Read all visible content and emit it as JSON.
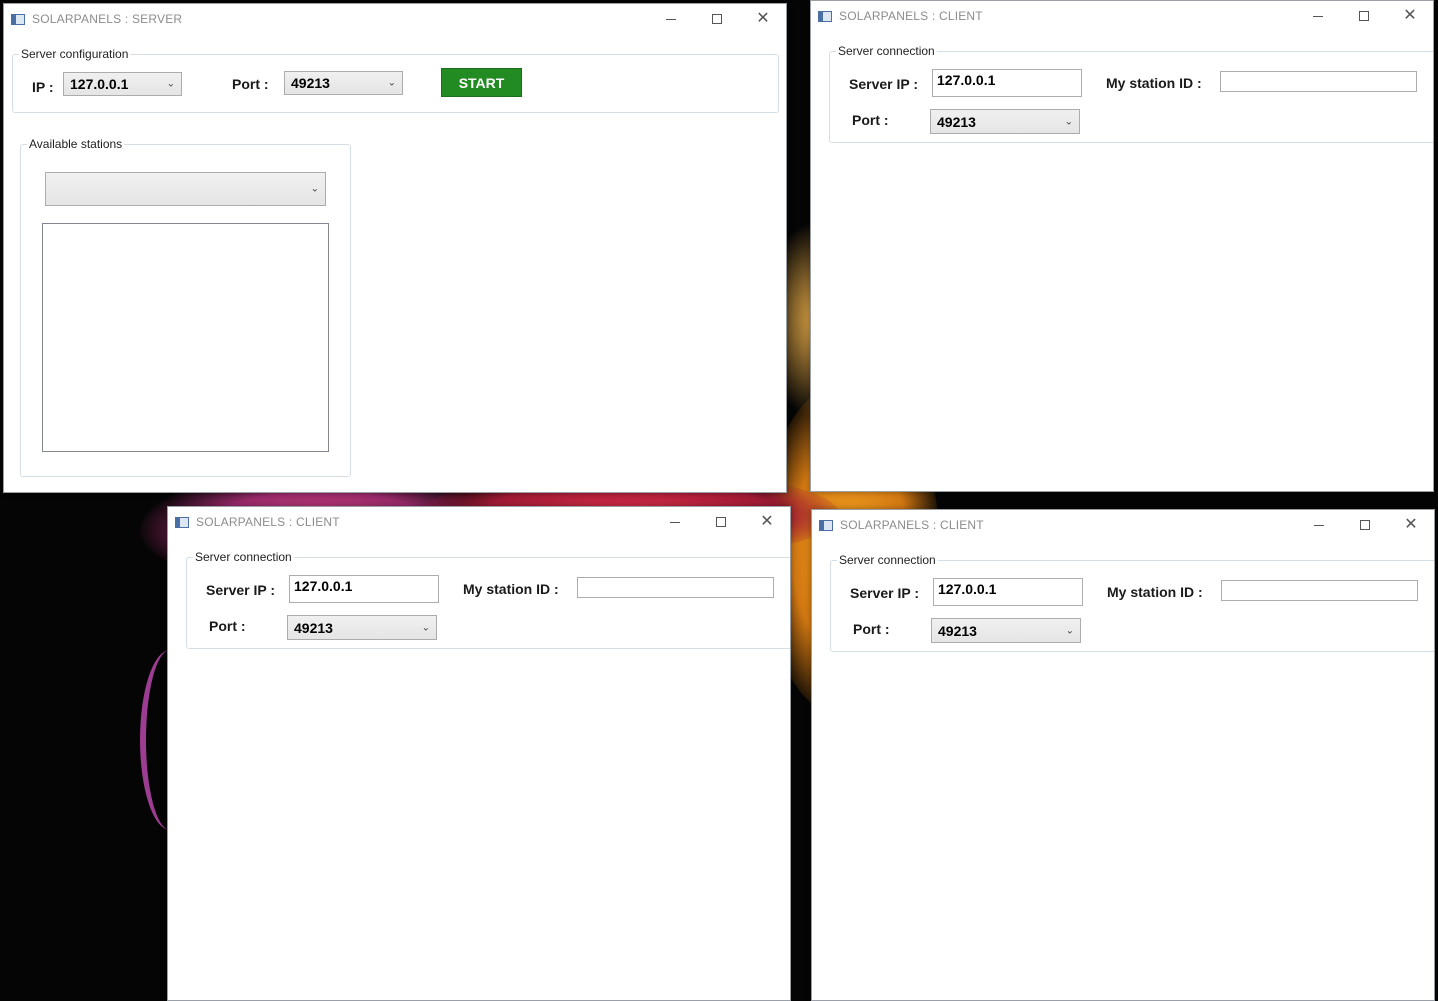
{
  "server_window": {
    "title": "SOLARPANELS : SERVER",
    "config_group": "Server configuration",
    "ip_label": "IP :",
    "ip_value": "127.0.0.1",
    "port_label": "Port :",
    "port_value": "49213",
    "start_label": "START",
    "stations_group": "Available stations",
    "stations_selected": ""
  },
  "client_windows": [
    {
      "title": "SOLARPANELS : CLIENT",
      "connection_group": "Server connection",
      "server_ip_label": "Server IP :",
      "server_ip_value": "127.0.0.1",
      "station_id_label": "My station ID :",
      "station_id_value": "",
      "port_label": "Port :",
      "port_value": "49213"
    },
    {
      "title": "SOLARPANELS : CLIENT",
      "connection_group": "Server connection",
      "server_ip_label": "Server IP :",
      "server_ip_value": "127.0.0.1",
      "station_id_label": "My station ID :",
      "station_id_value": "",
      "port_label": "Port :",
      "port_value": "49213"
    },
    {
      "title": "SOLARPANELS : CLIENT",
      "connection_group": "Server connection",
      "server_ip_label": "Server IP :",
      "server_ip_value": "127.0.0.1",
      "station_id_label": "My station ID :",
      "station_id_value": "",
      "port_label": "Port :",
      "port_value": "49213"
    }
  ],
  "colors": {
    "start_button": "#228b22",
    "title_text": "#8c8c8c"
  }
}
